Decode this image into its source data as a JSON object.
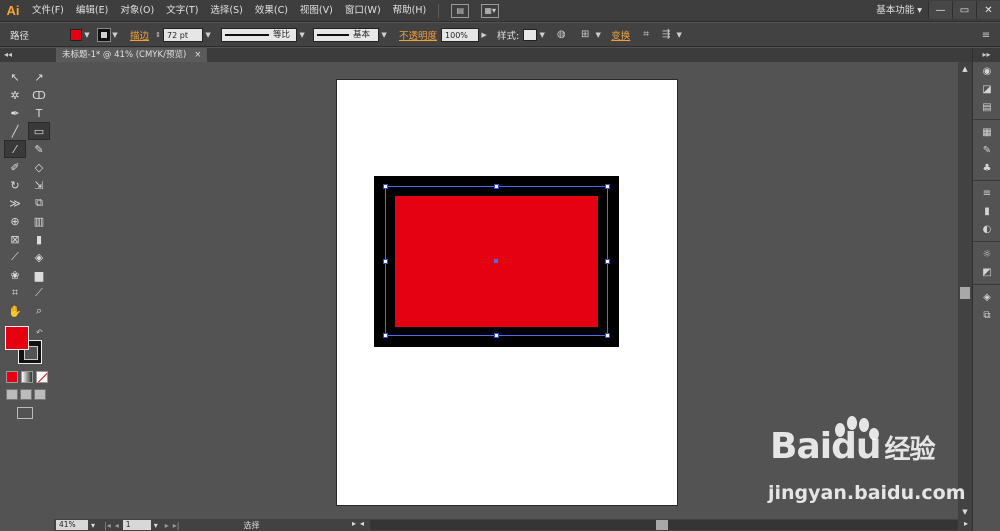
{
  "app": {
    "logo": "Ai",
    "menu": [
      "文件(F)",
      "编辑(E)",
      "对象(O)",
      "文字(T)",
      "选择(S)",
      "效果(C)",
      "视图(V)",
      "窗口(W)",
      "帮助(H)"
    ],
    "workspace": "基本功能",
    "window_controls": [
      "—",
      "▭",
      "✕"
    ]
  },
  "control_bar": {
    "selection_type": "路径",
    "fill_color": "#e50012",
    "stroke_label": "描边",
    "stroke_weight": "72 pt",
    "profile_label": "等比",
    "brush_label": "基本",
    "opacity_label": "不透明度",
    "opacity_value": "100%",
    "style_label": "样式:",
    "transform_label": "变换"
  },
  "document": {
    "tab_title": "未标题-1* @ 41% (CMYK/预览)",
    "tab_close": "×"
  },
  "artwork": {
    "outer_color": "#000000",
    "inner_color": "#e50012",
    "selection_color": "#4a6cf0"
  },
  "status_bar": {
    "zoom": "41%",
    "page": "1",
    "tool": "选择"
  },
  "watermark": {
    "logo_text": "Bai",
    "logo_text2": "du",
    "logo_suffix": "经验",
    "url": "jingyan.baidu.com"
  }
}
